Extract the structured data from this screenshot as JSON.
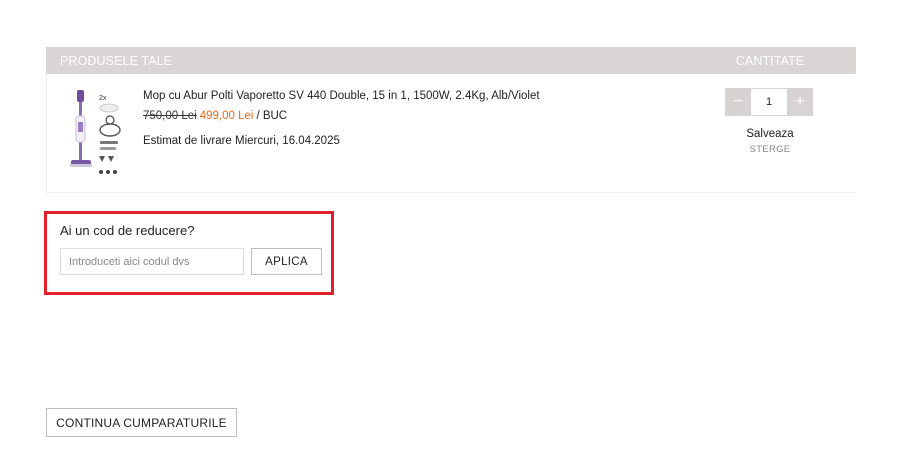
{
  "cart": {
    "header": {
      "products_label": "PRODUSELE TALE",
      "quantity_label": "CANTITATE"
    },
    "items": [
      {
        "name": "Mop cu Abur Polti Vaporetto SV 440 Double, 15 in 1, 1500W, 2.4Kg, Alb/Violet",
        "old_price": "750,00 Lei",
        "new_price": "499,00 Lei",
        "unit": "/ BUC",
        "delivery": "Estimat de livrare Miercuri, 16.04.2025",
        "thumb_badge": "2x",
        "quantity": "1",
        "decrement_symbol": "−",
        "increment_symbol": "+",
        "save_label": "Salveaza",
        "delete_label": "STERGE"
      }
    ]
  },
  "coupon": {
    "title": "Ai un cod de reducere?",
    "placeholder": "Introduceti aici codul dvs",
    "value": "",
    "apply_label": "APLICA"
  },
  "continue_shopping_label": "CONTINUA CUMPARATURILE",
  "colors": {
    "header_bg": "#d8d5d4",
    "sale_price": "#e86a1c",
    "highlight_border": "#e0202a",
    "stepper_bg": "#d6d3d2"
  },
  "icons": {
    "decrement": "minus-icon",
    "increment": "plus-icon"
  }
}
